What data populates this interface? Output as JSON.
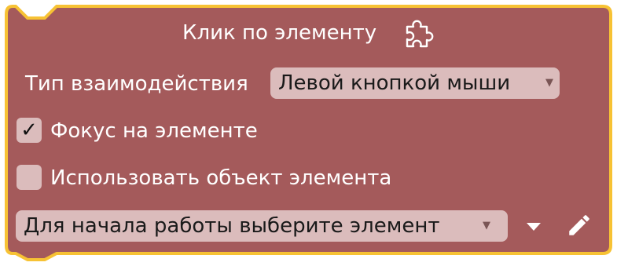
{
  "block": {
    "title": "Клик по элементу",
    "colors": {
      "fill": "#a45a5b",
      "outline": "#f7c234",
      "field": "#dbbcbc"
    }
  },
  "interaction": {
    "label": "Тип взаимодействия",
    "value": "Левой кнопкой мыши"
  },
  "focus": {
    "label": "Фокус на элементе",
    "checked": true,
    "check_glyph": "✓"
  },
  "use_object": {
    "label": "Использовать объект элемента",
    "checked": false
  },
  "element_select": {
    "value": "Для начала работы выберите элемент"
  },
  "icons": {
    "header": "puzzle-icon",
    "dropdown": "chevron-down-icon",
    "edit": "pencil-icon"
  }
}
